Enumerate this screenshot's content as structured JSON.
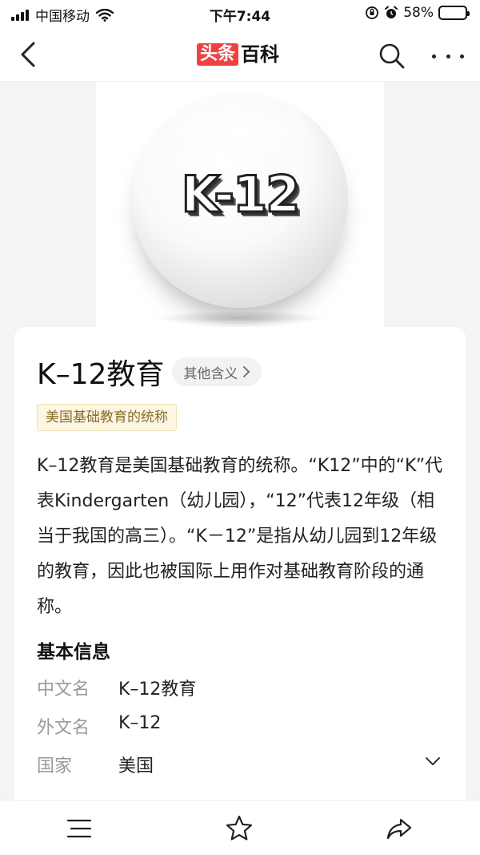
{
  "status_bar": {
    "carrier": "中国移动",
    "time": "下午7:44",
    "battery": "58%",
    "battery_level": 0.58
  },
  "nav": {
    "logo_part1": "头条",
    "logo_part2": "百科"
  },
  "hero": {
    "image_text": "K-12"
  },
  "entry": {
    "title": "K–12教育",
    "other_meanings_label": "其他含义",
    "tag": "美国基础教育的统称",
    "summary": "K–12教育是美国基础教育的统称。“K12”中的“K”代表Kindergarten（幼儿园），“12”代表12年级（相当于我国的高三）。“K－12”是指从幼儿园到12年级的教育，因此也被国际上用作对基础教育阶段的通称。"
  },
  "basic_info": {
    "title": "基本信息",
    "rows": [
      {
        "key": "中文名",
        "value": "K–12教育"
      },
      {
        "key": "外文名",
        "value": "K–12"
      },
      {
        "key": "国家",
        "value": "美国"
      }
    ]
  },
  "icons": {
    "back": "chevron-left-icon",
    "search": "search-icon",
    "more": "more-icon",
    "expand": "chevron-down-icon",
    "menu": "menu-icon",
    "star": "star-icon",
    "share": "share-icon"
  },
  "colors": {
    "brand_red": "#f04142",
    "tag_bg": "#fcf6e3",
    "tag_text": "#8a6d2b"
  }
}
